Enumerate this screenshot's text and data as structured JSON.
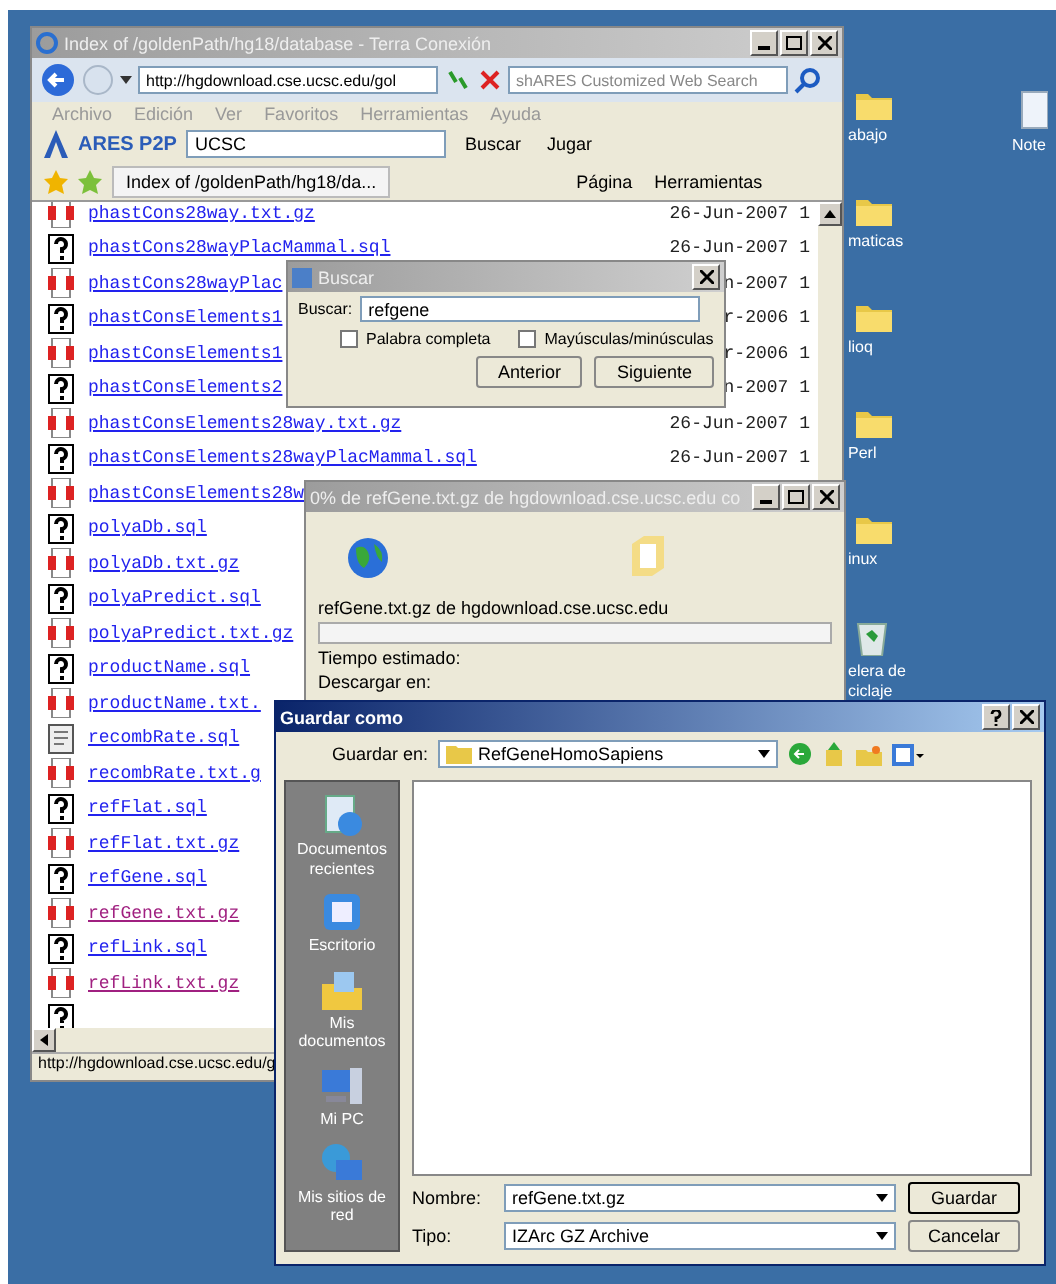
{
  "browser": {
    "title": "Index of /goldenPath/hg18/database - Terra Conexión",
    "address": "http://hgdownload.cse.ucsc.edu/gol",
    "search_placeholder": "shARES Customized Web Search",
    "menu": [
      "Archivo",
      "Edición",
      "Ver",
      "Favoritos",
      "Herramientas",
      "Ayuda"
    ],
    "toolbar": {
      "brand": "ARES P2P",
      "search_value": "UCSC",
      "buttons": [
        "Buscar",
        "Jugar"
      ]
    },
    "tab": "Index of /goldenPath/hg18/da...",
    "command_bar": [
      "Página",
      "Herramientas"
    ],
    "files": [
      {
        "name": "phastCons28way.txt.gz",
        "date": "26-Jun-2007 1",
        "kind": "archive",
        "visited": false
      },
      {
        "name": "phastCons28wayPlacMammal.sql",
        "date": "26-Jun-2007 1",
        "kind": "unknown",
        "visited": false
      },
      {
        "name": "phastCons28wayPlac",
        "date": "n-2007 1",
        "kind": "archive",
        "visited": false
      },
      {
        "name": "phastConsElements1",
        "date": "r-2006 1",
        "kind": "unknown",
        "visited": false
      },
      {
        "name": "phastConsElements1",
        "date": "r-2006 1",
        "kind": "archive",
        "visited": false
      },
      {
        "name": "phastConsElements2",
        "date": "n-2007 1",
        "kind": "unknown",
        "visited": false
      },
      {
        "name": "phastConsElements28way.txt.gz",
        "date": "26-Jun-2007 1",
        "kind": "archive",
        "visited": false
      },
      {
        "name": "phastConsElements28wayPlacMammal.sql",
        "date": "26-Jun-2007 1",
        "kind": "unknown",
        "visited": false
      },
      {
        "name": "phastConsElements28w",
        "kind": "archive",
        "visited": false
      },
      {
        "name": "polyaDb.sql",
        "kind": "unknown",
        "visited": false
      },
      {
        "name": "polyaDb.txt.gz",
        "kind": "archive",
        "visited": false
      },
      {
        "name": "polyaPredict.sql",
        "kind": "unknown",
        "visited": false
      },
      {
        "name": "polyaPredict.txt.gz",
        "kind": "archive",
        "visited": false
      },
      {
        "name": "productName.sql",
        "kind": "unknown",
        "visited": false
      },
      {
        "name": "productName.txt.",
        "kind": "archive",
        "visited": false
      },
      {
        "name": "recombRate.sql",
        "kind": "text",
        "visited": false
      },
      {
        "name": "recombRate.txt.g",
        "kind": "archive",
        "visited": false
      },
      {
        "name": "refFlat.sql",
        "kind": "unknown",
        "visited": false
      },
      {
        "name": "refFlat.txt.gz",
        "kind": "archive",
        "visited": false
      },
      {
        "name": "refGene.sql",
        "kind": "unknown",
        "visited": false
      },
      {
        "name": "refGene.txt.gz",
        "kind": "archive",
        "visited": true
      },
      {
        "name": "refLink.sql",
        "kind": "unknown",
        "visited": false
      },
      {
        "name": "refLink.txt.gz",
        "kind": "archive",
        "visited": true
      },
      {
        "kind": "unknown"
      }
    ],
    "status": "http://hgdownload.cse.ucsc.edu/g"
  },
  "find_dialog": {
    "title": "Buscar",
    "label": "Buscar:",
    "value": "refgene",
    "options": [
      {
        "label": "Palabra completa",
        "checked": false
      },
      {
        "label": "Mayúsculas/minúsculas",
        "checked": false
      }
    ],
    "buttons": [
      "Anterior",
      "Siguiente"
    ]
  },
  "download_dialog": {
    "title": "0% de refGene.txt.gz de hgdownload.cse.ucsc.edu co",
    "source": "refGene.txt.gz de hgdownload.cse.ucsc.edu",
    "level": 0,
    "labels": [
      "Tiempo estimado:",
      "Descargar en:"
    ]
  },
  "save_dialog": {
    "title": "Guardar como",
    "location_label": "Guardar en:",
    "location": "RefGeneHomoSapiens",
    "places": [
      {
        "label": "Documentos recientes",
        "kind": "recent"
      },
      {
        "label": "Escritorio",
        "kind": "desktop"
      },
      {
        "label": "Mis documentos",
        "kind": "documents"
      },
      {
        "label": "Mi PC",
        "kind": "computer"
      },
      {
        "label": "Mis sitios de red",
        "kind": "network"
      }
    ],
    "name_label": "Nombre:",
    "name_value": "refGene.txt.gz",
    "type_label": "Tipo:",
    "type_value": "IZArc GZ Archive",
    "buttons": [
      "Guardar",
      "Cancelar"
    ]
  },
  "desktop_icons": [
    {
      "label": "abajo",
      "kind": "folder"
    },
    {
      "label": "maticas",
      "kind": "folder"
    },
    {
      "label": "lioq",
      "kind": "folder"
    },
    {
      "label": "Perl",
      "kind": "folder"
    },
    {
      "label": "inux",
      "kind": "folder"
    },
    {
      "label": "elera de ciclaje",
      "kind": "recycle"
    },
    {
      "label": "Note",
      "kind": "document"
    }
  ]
}
